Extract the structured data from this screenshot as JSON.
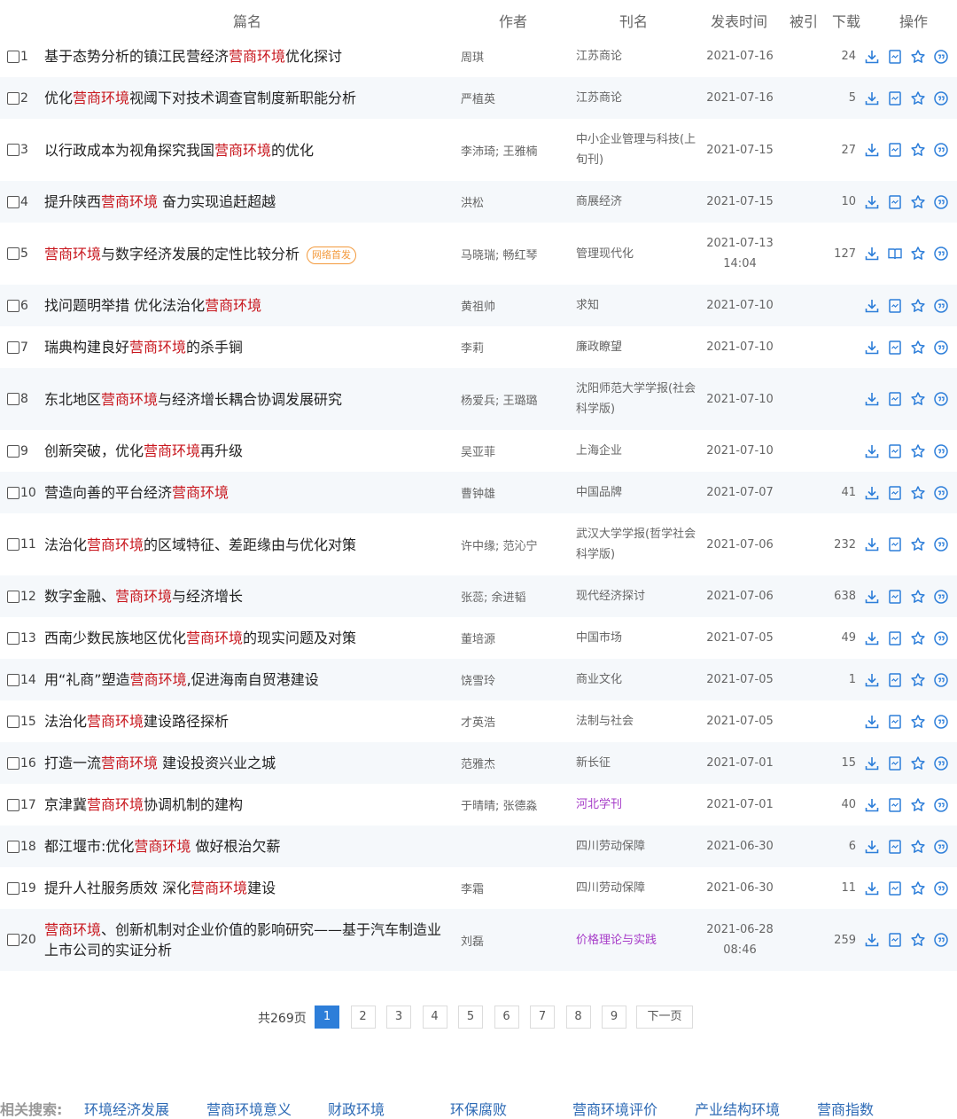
{
  "header": {
    "title": "篇名",
    "author": "作者",
    "source": "刊名",
    "date": "发表时间",
    "cited": "被引",
    "downloads": "下载",
    "ops": "操作"
  },
  "rows": [
    {
      "no": "1",
      "parts": [
        "基于态势分析的镇江民营经济",
        "营商环境",
        "优化探讨"
      ],
      "author": "周琪",
      "source": "江苏商论",
      "date": "2021-07-16",
      "cited": "",
      "downloads": "24",
      "badge": ""
    },
    {
      "no": "2",
      "parts": [
        "优化",
        "营商环境",
        "视阈下对技术调查官制度新职能分析"
      ],
      "author": "严植英",
      "source": "江苏商论",
      "date": "2021-07-16",
      "cited": "",
      "downloads": "5",
      "badge": ""
    },
    {
      "no": "3",
      "parts": [
        "以行政成本为视角探究我国",
        "营商环境",
        "的优化"
      ],
      "author": "李沛琦; 王雅楠",
      "source": "中小企业管理与科技(上旬刊)",
      "date": "2021-07-15",
      "cited": "",
      "downloads": "27",
      "badge": ""
    },
    {
      "no": "4",
      "parts": [
        "提升陕西",
        "营商环境",
        " 奋力实现追赶超越"
      ],
      "author": "洪松",
      "source": "商展经济",
      "date": "2021-07-15",
      "cited": "",
      "downloads": "10",
      "badge": ""
    },
    {
      "no": "5",
      "parts": [
        "",
        "营商环境",
        "与数字经济发展的定性比较分析"
      ],
      "author": "马晓瑞; 畅红琴",
      "source": "管理现代化",
      "date": "2021-07-13 14:04",
      "cited": "",
      "downloads": "127",
      "badge": "网络首发"
    },
    {
      "no": "6",
      "parts": [
        "找问题明举措 优化法治化",
        "营商环境",
        ""
      ],
      "author": "黄祖帅",
      "source": "求知",
      "date": "2021-07-10",
      "cited": "",
      "downloads": "",
      "badge": ""
    },
    {
      "no": "7",
      "parts": [
        "瑞典构建良好",
        "营商环境",
        "的杀手锏"
      ],
      "author": "李莉",
      "source": "廉政瞭望",
      "date": "2021-07-10",
      "cited": "",
      "downloads": "",
      "badge": ""
    },
    {
      "no": "8",
      "parts": [
        "东北地区",
        "营商环境",
        "与经济增长耦合协调发展研究"
      ],
      "author": "杨爱兵; 王璐璐",
      "source": "沈阳师范大学学报(社会科学版)",
      "date": "2021-07-10",
      "cited": "",
      "downloads": "",
      "badge": ""
    },
    {
      "no": "9",
      "parts": [
        "创新突破，优化",
        "营商环境",
        "再升级"
      ],
      "author": "吴亚菲",
      "source": "上海企业",
      "date": "2021-07-10",
      "cited": "",
      "downloads": "",
      "badge": ""
    },
    {
      "no": "10",
      "parts": [
        "营造向善的平台经济",
        "营商环境",
        ""
      ],
      "author": "曹钟雄",
      "source": "中国品牌",
      "date": "2021-07-07",
      "cited": "",
      "downloads": "41",
      "badge": ""
    },
    {
      "no": "11",
      "parts": [
        "法治化",
        "营商环境",
        "的区域特征、差距缘由与优化对策"
      ],
      "author": "许中缘; 范沁宁",
      "source": "武汉大学学报(哲学社会科学版)",
      "date": "2021-07-06",
      "cited": "",
      "downloads": "232",
      "badge": ""
    },
    {
      "no": "12",
      "parts": [
        "数字金融、",
        "营商环境",
        "与经济增长"
      ],
      "author": "张蕊; 余进韬",
      "source": "现代经济探讨",
      "date": "2021-07-06",
      "cited": "",
      "downloads": "638",
      "badge": ""
    },
    {
      "no": "13",
      "parts": [
        "西南少数民族地区优化",
        "营商环境",
        "的现实问题及对策"
      ],
      "author": "董培源",
      "source": "中国市场",
      "date": "2021-07-05",
      "cited": "",
      "downloads": "49",
      "badge": ""
    },
    {
      "no": "14",
      "parts": [
        "用“礼商”塑造",
        "营商环境",
        ",促进海南自贸港建设"
      ],
      "author": "饶雪玲",
      "source": "商业文化",
      "date": "2021-07-05",
      "cited": "",
      "downloads": "1",
      "badge": ""
    },
    {
      "no": "15",
      "parts": [
        "法治化",
        "营商环境",
        "建设路径探析"
      ],
      "author": "才英浩",
      "source": "法制与社会",
      "date": "2021-07-05",
      "cited": "",
      "downloads": "",
      "badge": ""
    },
    {
      "no": "16",
      "parts": [
        "打造一流",
        "营商环境",
        " 建设投资兴业之城"
      ],
      "author": "范雅杰",
      "source": "新长征",
      "date": "2021-07-01",
      "cited": "",
      "downloads": "15",
      "badge": ""
    },
    {
      "no": "17",
      "parts": [
        "京津冀",
        "营商环境",
        "协调机制的建构"
      ],
      "author": "于晴晴; 张德淼",
      "source": "河北学刊",
      "date": "2021-07-01",
      "cited": "",
      "downloads": "40",
      "badge": "",
      "purple": true
    },
    {
      "no": "18",
      "parts": [
        "都江堰市:优化",
        "营商环境",
        " 做好根治欠薪"
      ],
      "author": "",
      "source": "四川劳动保障",
      "date": "2021-06-30",
      "cited": "",
      "downloads": "6",
      "badge": ""
    },
    {
      "no": "19",
      "parts": [
        "提升人社服务质效 深化",
        "营商环境",
        "建设"
      ],
      "author": "李霜",
      "source": "四川劳动保障",
      "date": "2021-06-30",
      "cited": "",
      "downloads": "11",
      "badge": ""
    },
    {
      "no": "20",
      "parts": [
        "",
        "营商环境",
        "、创新机制对企业价值的影响研究——基于汽车制造业上市公司的实证分析"
      ],
      "author": "刘磊",
      "source": "价格理论与实践",
      "date": "2021-06-28 08:46",
      "cited": "",
      "downloads": "259",
      "badge": "",
      "purple": true
    }
  ],
  "pagination": {
    "total": "共269页",
    "pages": [
      "1",
      "2",
      "3",
      "4",
      "5",
      "6",
      "7",
      "8",
      "9"
    ],
    "active": "1",
    "next": "下一页"
  },
  "related": {
    "label": "相关搜索:",
    "links": [
      "环境经济发展",
      "营商环境意义",
      "财政环境",
      "环保腐败",
      "营商环境评价",
      "产业结构环境",
      "营商指数"
    ]
  },
  "icons": [
    "download-icon",
    "read-online-icon",
    "favorite-star-icon",
    "quote-icon"
  ],
  "colors": {
    "highlight": "#c8161d",
    "link": "#2d6ab5",
    "active_page": "#2d7ed9",
    "badge": "#f39a3d",
    "purple_source": "#a63cc8",
    "row_alt": "#f5f8fb"
  }
}
